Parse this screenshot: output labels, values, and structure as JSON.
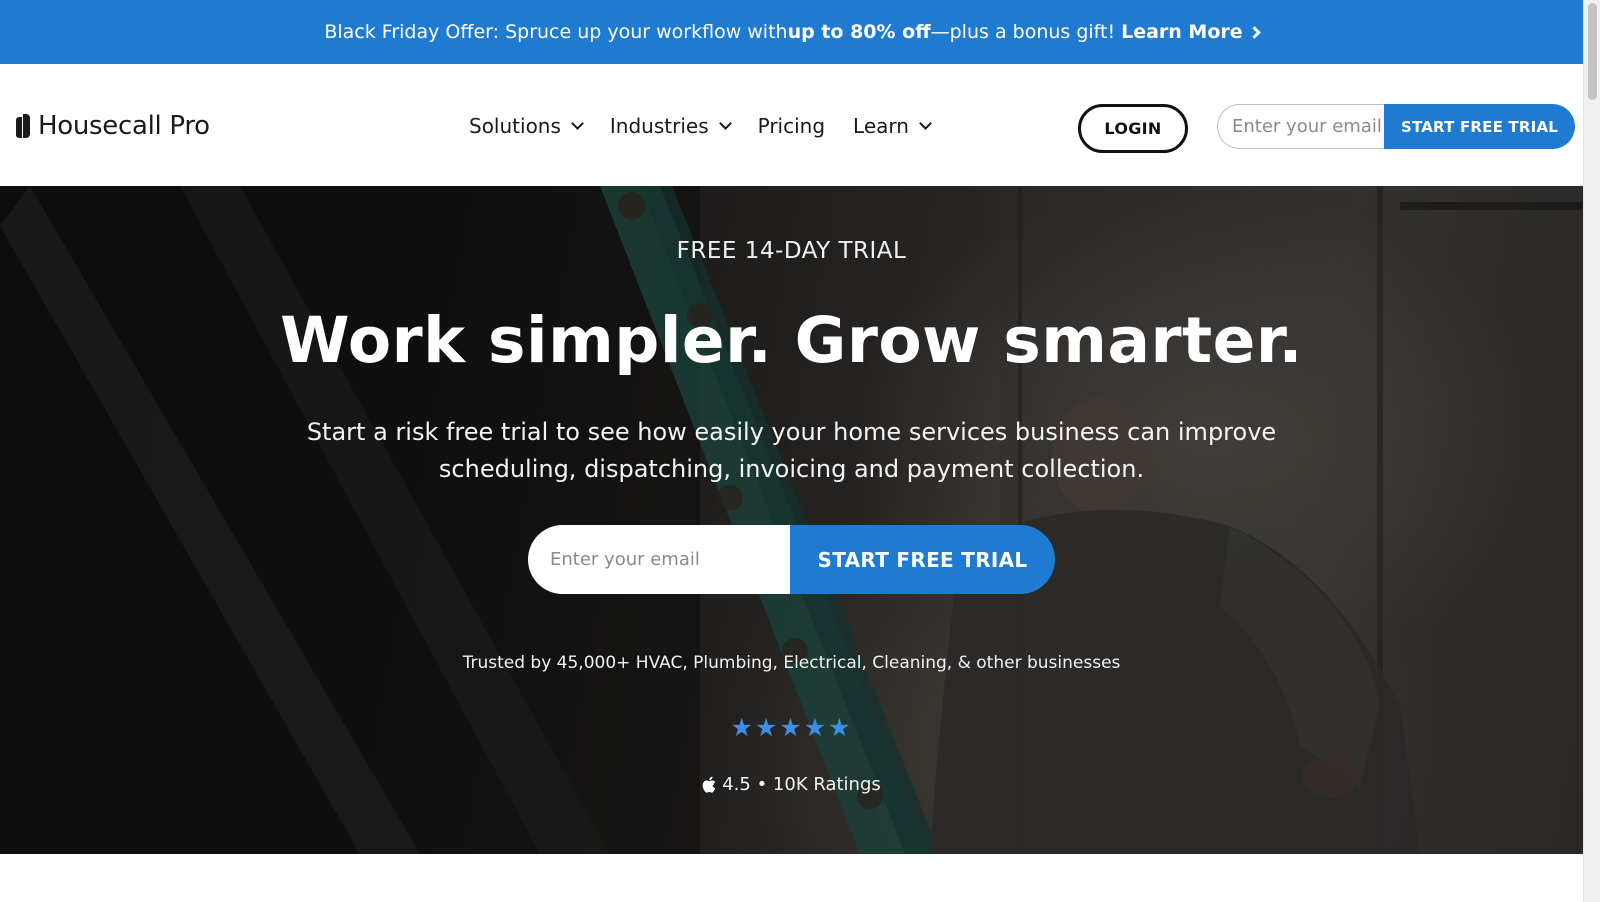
{
  "promo": {
    "text_before": "Black Friday Offer: Spruce up your workflow with ",
    "text_bold": "up to 80% off",
    "text_after": "—plus a bonus gift!",
    "link_label": "Learn More"
  },
  "header": {
    "logo_text": "Housecall Pro",
    "nav": [
      {
        "label": "Solutions",
        "has_dropdown": true
      },
      {
        "label": "Industries",
        "has_dropdown": true
      },
      {
        "label": "Pricing",
        "has_dropdown": false
      },
      {
        "label": "Learn",
        "has_dropdown": true
      }
    ],
    "login_label": "LOGIN",
    "email_placeholder": "Enter your email",
    "cta_label": "START FREE TRIAL"
  },
  "hero": {
    "eyebrow": "FREE 14-DAY TRIAL",
    "headline": "Work simpler. Grow smarter.",
    "subhead": "Start a risk free trial to see how easily your home services business can improve scheduling, dispatching, invoicing and payment collection.",
    "email_placeholder": "Enter your email",
    "cta_label": "START FREE TRIAL",
    "trust_text": "Trusted by 45,000+ HVAC, Plumbing, Electrical, Cleaning, & other businesses",
    "stars": "★★★★★",
    "star_rating": 5,
    "rating_text": "4.5 • 10K Ratings"
  },
  "colors": {
    "brand_blue": "#1f7bd1",
    "star_blue": "#3b8ee6"
  },
  "icons": {
    "promo_link": "chevron-right-icon",
    "nav_dropdown": "chevron-down-icon",
    "rating_source": "apple-icon",
    "logo": "housecall-logo-mark"
  }
}
